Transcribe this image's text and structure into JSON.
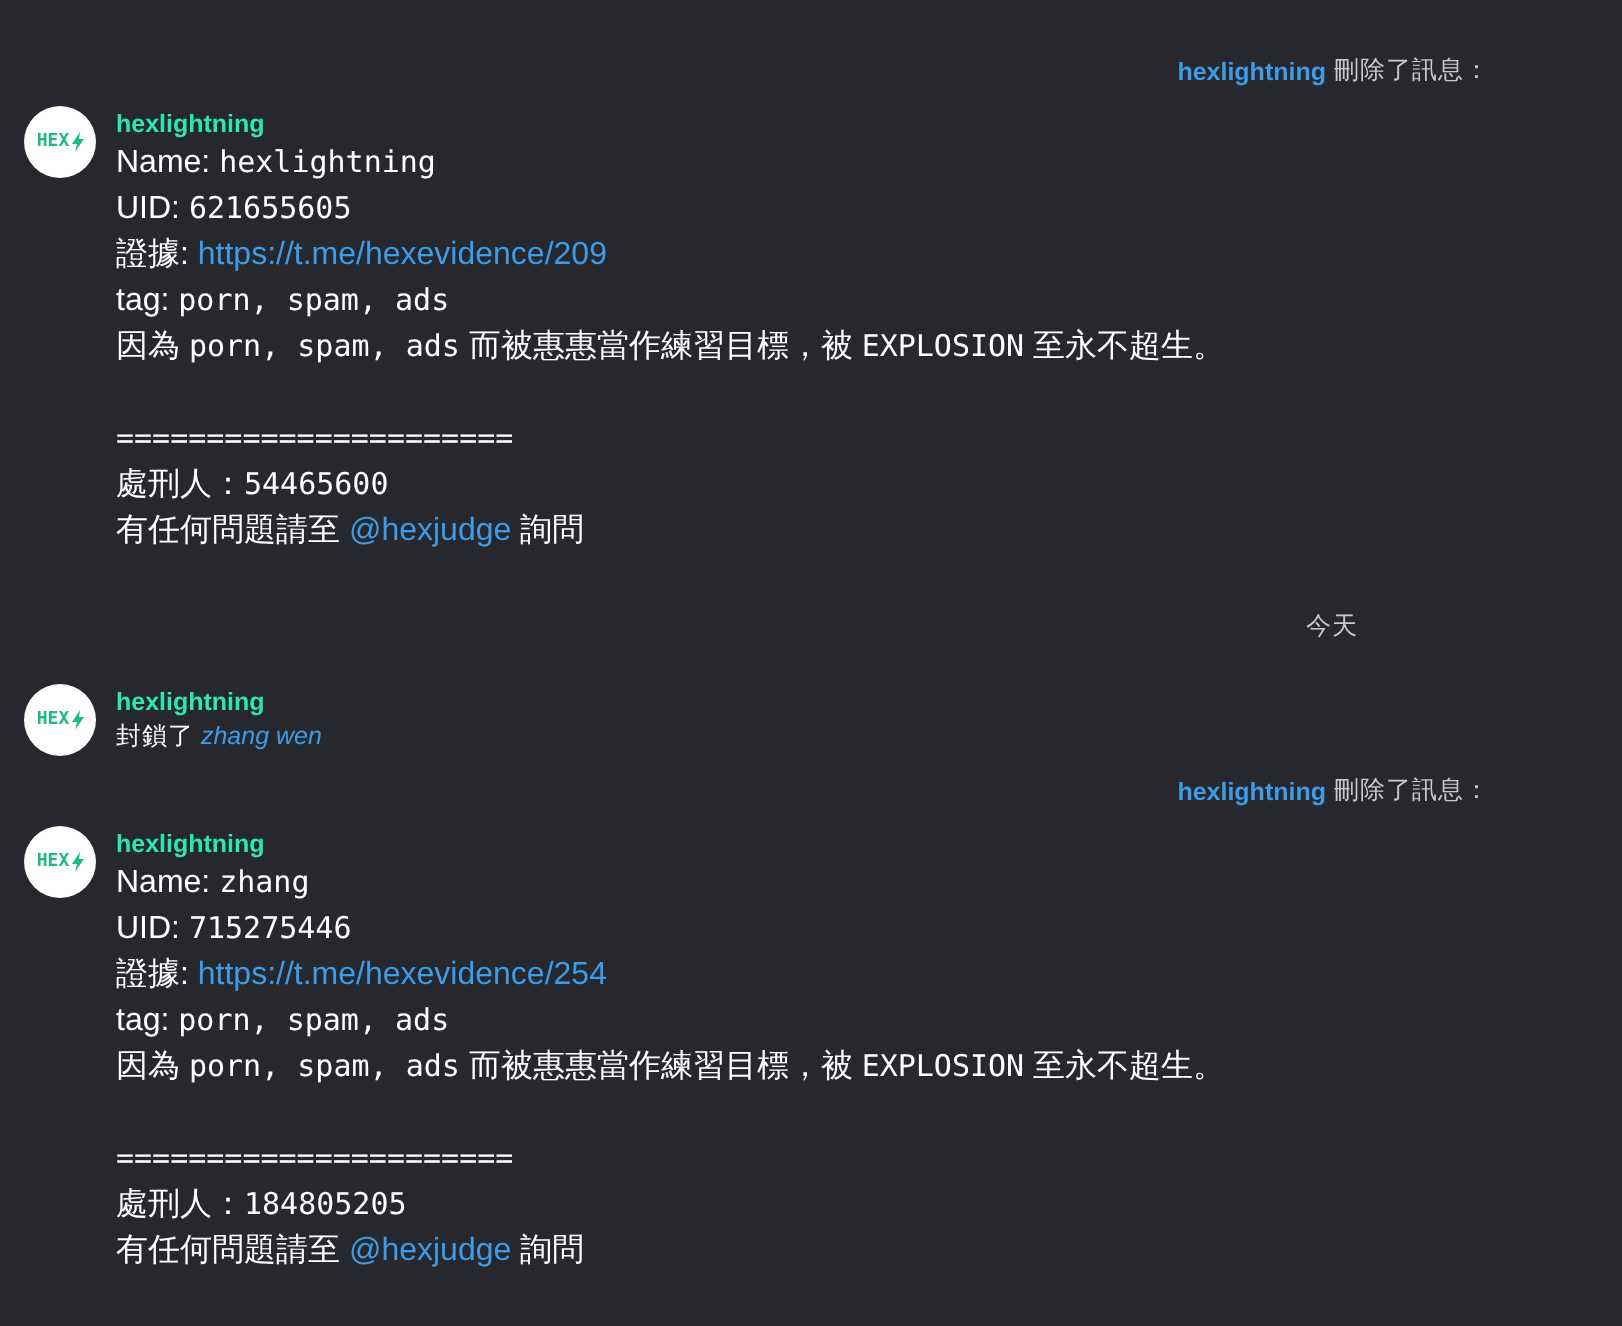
{
  "events": [
    {
      "kind": "notice",
      "actor": "hexlightning",
      "action": "刪除了訊息："
    },
    {
      "kind": "message",
      "sender": "hexlightning",
      "avatar": "HEX",
      "paragraphs": [
        {
          "lines": [
            [
              {
                "kind": "text",
                "text": "Name: "
              },
              {
                "kind": "mono",
                "text": "hexlightning"
              }
            ],
            [
              {
                "kind": "text",
                "text": "UID: "
              },
              {
                "kind": "mono",
                "text": "621655605"
              }
            ],
            [
              {
                "kind": "text",
                "text": "證據: "
              },
              {
                "kind": "link",
                "text": "https://t.me/hexevidence/209"
              }
            ],
            [
              {
                "kind": "text",
                "text": "tag: "
              },
              {
                "kind": "mono",
                "text": "porn, spam, ads"
              }
            ],
            [
              {
                "kind": "text",
                "text": "因為 "
              },
              {
                "kind": "mono",
                "text": "porn, spam, ads"
              },
              {
                "kind": "text",
                "text": " 而被惠惠當作練習目標，被 "
              },
              {
                "kind": "mono",
                "text": "EXPLOSION"
              },
              {
                "kind": "text",
                "text": " 至永不超生。"
              }
            ]
          ]
        },
        {
          "lines": [
            [
              {
                "kind": "mono",
                "text": "======================"
              }
            ],
            [
              {
                "kind": "text",
                "text": "處刑人："
              },
              {
                "kind": "mono",
                "text": "54465600"
              }
            ],
            [
              {
                "kind": "text",
                "text": "有任何問題請至 "
              },
              {
                "kind": "link",
                "text": "@hexjudge"
              },
              {
                "kind": "text",
                "text": " 詢問"
              }
            ]
          ]
        }
      ]
    },
    {
      "kind": "date",
      "text": "今天"
    },
    {
      "kind": "service",
      "sender": "hexlightning",
      "avatar": "HEX",
      "action": "封鎖了",
      "target": "zhang wen"
    },
    {
      "kind": "notice",
      "actor": "hexlightning",
      "action": "刪除了訊息："
    },
    {
      "kind": "message",
      "sender": "hexlightning",
      "avatar": "HEX",
      "paragraphs": [
        {
          "lines": [
            [
              {
                "kind": "text",
                "text": "Name: "
              },
              {
                "kind": "mono",
                "text": "zhang"
              }
            ],
            [
              {
                "kind": "text",
                "text": "UID: "
              },
              {
                "kind": "mono",
                "text": "715275446"
              }
            ],
            [
              {
                "kind": "text",
                "text": "證據: "
              },
              {
                "kind": "link",
                "text": "https://t.me/hexevidence/254"
              }
            ],
            [
              {
                "kind": "text",
                "text": "tag: "
              },
              {
                "kind": "mono",
                "text": "porn, spam, ads"
              }
            ],
            [
              {
                "kind": "text",
                "text": "因為 "
              },
              {
                "kind": "mono",
                "text": "porn, spam, ads"
              },
              {
                "kind": "text",
                "text": " 而被惠惠當作練習目標，被 "
              },
              {
                "kind": "mono",
                "text": "EXPLOSION"
              },
              {
                "kind": "text",
                "text": " 至永不超生。"
              }
            ]
          ]
        },
        {
          "lines": [
            [
              {
                "kind": "mono",
                "text": "======================"
              }
            ],
            [
              {
                "kind": "text",
                "text": "處刑人："
              },
              {
                "kind": "mono",
                "text": "184805205"
              }
            ],
            [
              {
                "kind": "text",
                "text": "有任何問題請至 "
              },
              {
                "kind": "link",
                "text": "@hexjudge"
              },
              {
                "kind": "text",
                "text": " 詢問"
              }
            ]
          ]
        }
      ]
    }
  ]
}
